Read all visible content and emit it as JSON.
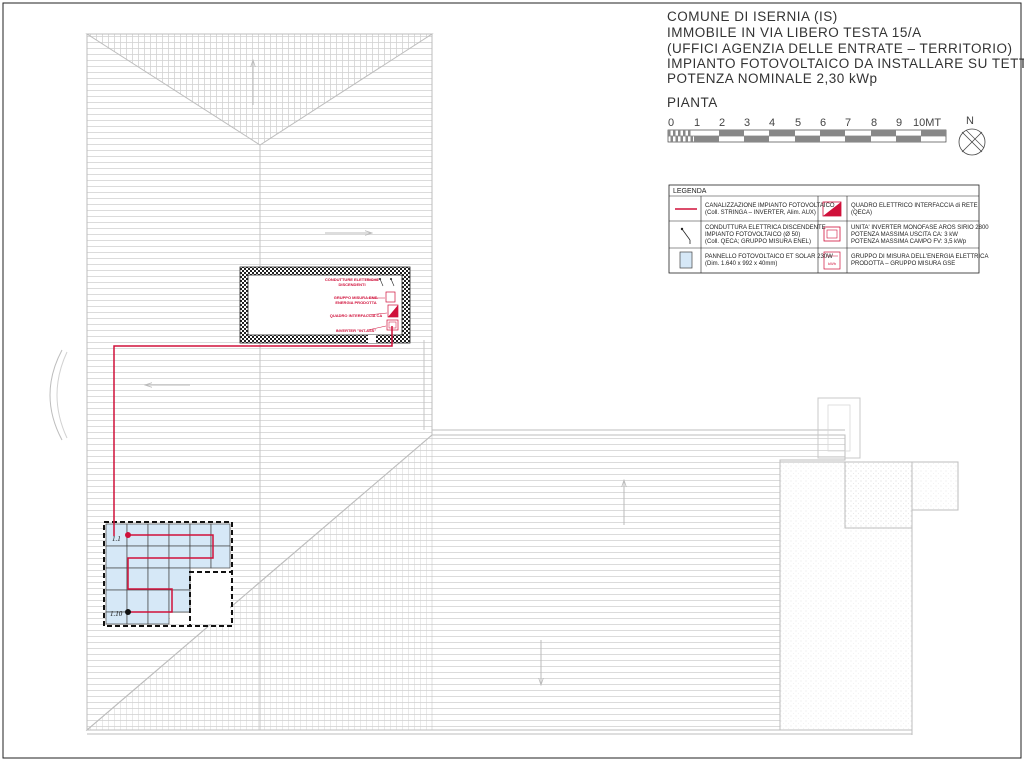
{
  "title": {
    "lines": [
      "COMUNE DI ISERNIA (IS)",
      "IMMOBILE IN VIA LIBERO TESTA 15/A",
      "(UFFICI AGENZIA DELLE ENTRATE – TERRITORIO)",
      "IMPIANTO FOTOVOLTAICO DA INSTALLARE SU TETTO",
      "POTENZA NOMINALE 2,30 kWp"
    ],
    "plan_label": "PIANTA"
  },
  "scale_bar": {
    "ticks": [
      "0",
      "1",
      "2",
      "3",
      "4",
      "5",
      "6",
      "7",
      "8",
      "9",
      "10MT"
    ]
  },
  "north": {
    "label": "N"
  },
  "legend": {
    "title": "LEGENDA",
    "rows": [
      {
        "left_lines": [
          "CANALIZZAZIONE IMPIANTO FOTOVOLTAICO",
          "(Coll. STRINGA – INVERTER, Alim. AUX)"
        ],
        "right_lines": [
          "QUADRO ELETTRICO INTERFACCIA di RETE",
          "(QECA)"
        ]
      },
      {
        "left_lines": [
          "CONDUTTURA ELETTRICA DISCENDENTE",
          "IMPIANTO FOTOVOLTAICO (Ø 50)",
          "(Coll. QECA; GRUPPO MISURA ENEL)"
        ],
        "right_lines": [
          "UNITA' INVERTER MONOFASE AROS SIRIO 2800",
          "POTENZA MASSIMA USCITA CA: 3 kW",
          "POTENZA MASSIMA CAMPO FV: 3,5 kWp"
        ]
      },
      {
        "left_lines": [
          "PANNELLO FOTOVOLTAICO ET SOLAR 230W",
          "(Dim. 1.640 x 992 x 40mm)"
        ],
        "right_lines": [
          "GRUPPO DI MISURA DELL'ENERGIA ELETTRICA",
          "PRODOTTA – GRUPPO MISURA GSE"
        ]
      }
    ]
  },
  "room_labels": {
    "conduit": [
      "CONDUTTURE ELETTRICHE",
      "DISCENDENTI"
    ],
    "meter": [
      "GRUPPO MISURA ENE.",
      "ENERGIA PRODOTTA"
    ],
    "interface": "QUADRO INTERFACCIA CA",
    "inverter": "INVERTER \"INT.ASS\""
  },
  "panels": {
    "start_label": "1.1",
    "end_label": "1.10"
  },
  "colors": {
    "line": "#d0103a",
    "panel_fill": "#d6e8f7",
    "hatch": "#cfcfcf",
    "roof_line": "#bdbdbd"
  }
}
